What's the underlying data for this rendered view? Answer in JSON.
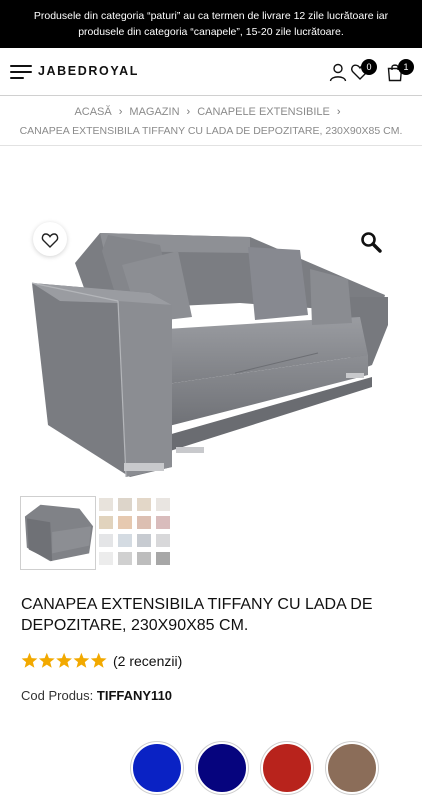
{
  "topbar": {
    "line1": "Produsele din categoria “paturi” au ca termen de livrare 12 zile lucrătoare iar",
    "line2": "produsele din categoria “canapele”, 15-20 zile lucrătoare."
  },
  "header": {
    "logo": "JABEDROYAL",
    "wishlist_count": "0",
    "cart_count": "1"
  },
  "breadcrumb": {
    "items": [
      "ACASĂ",
      "MAGAZIN",
      "CANAPELE EXTENSIBILE"
    ],
    "current": "CANAPEA EXTENSIBILA TIFFANY CU LADA DE DEPOZITARE, 230X90X85 CM."
  },
  "product": {
    "title": "CANAPEA EXTENSIBILA TIFFANY CU LADA DE DEPOZITARE, 230X90X85 CM.",
    "rating": 5,
    "reviews_label": "(2 recenzii)",
    "sku_label": "Cod Produs:",
    "sku_value": "TIFFANY110"
  },
  "colors": {
    "star": "#f2a900",
    "upholstery": "#8a8c91",
    "swatches": [
      {
        "name": "blue",
        "color": "#0a22c4"
      },
      {
        "name": "navy",
        "color": "#06047e"
      },
      {
        "name": "red",
        "color": "#b8231c"
      },
      {
        "name": "brown",
        "color": "#8b6d59"
      }
    ]
  },
  "icons": [
    "menu-icon",
    "user-icon",
    "heart-icon",
    "bag-icon",
    "search-zoom-icon",
    "star-icon"
  ]
}
